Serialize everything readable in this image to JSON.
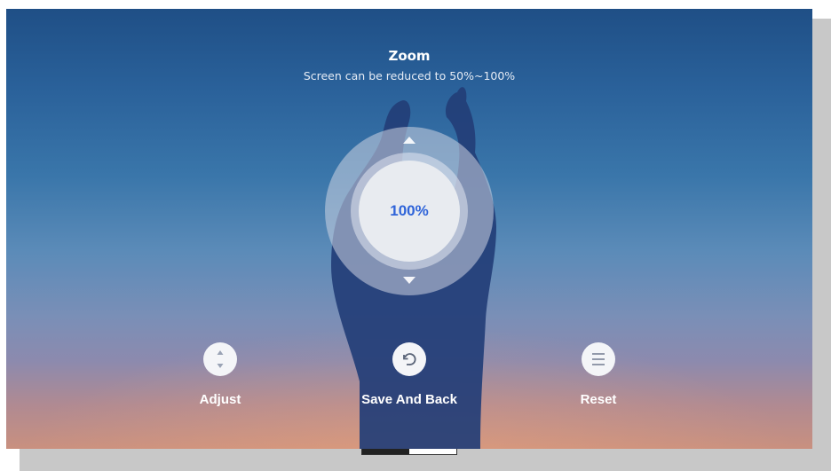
{
  "dialog": {
    "title": "Zoom",
    "subtitle": "Screen can be reduced to 50%~100%"
  },
  "zoom": {
    "value_label": "100%",
    "value": 100,
    "min": 50,
    "max": 100,
    "accent_color": "#2f64d9"
  },
  "actions": {
    "adjust": {
      "label": "Adjust",
      "icon": "up-down-arrows-icon"
    },
    "save": {
      "label": "Save And Back",
      "icon": "undo-arrow-icon"
    },
    "reset": {
      "label": "Reset",
      "icon": "menu-lines-icon"
    }
  }
}
